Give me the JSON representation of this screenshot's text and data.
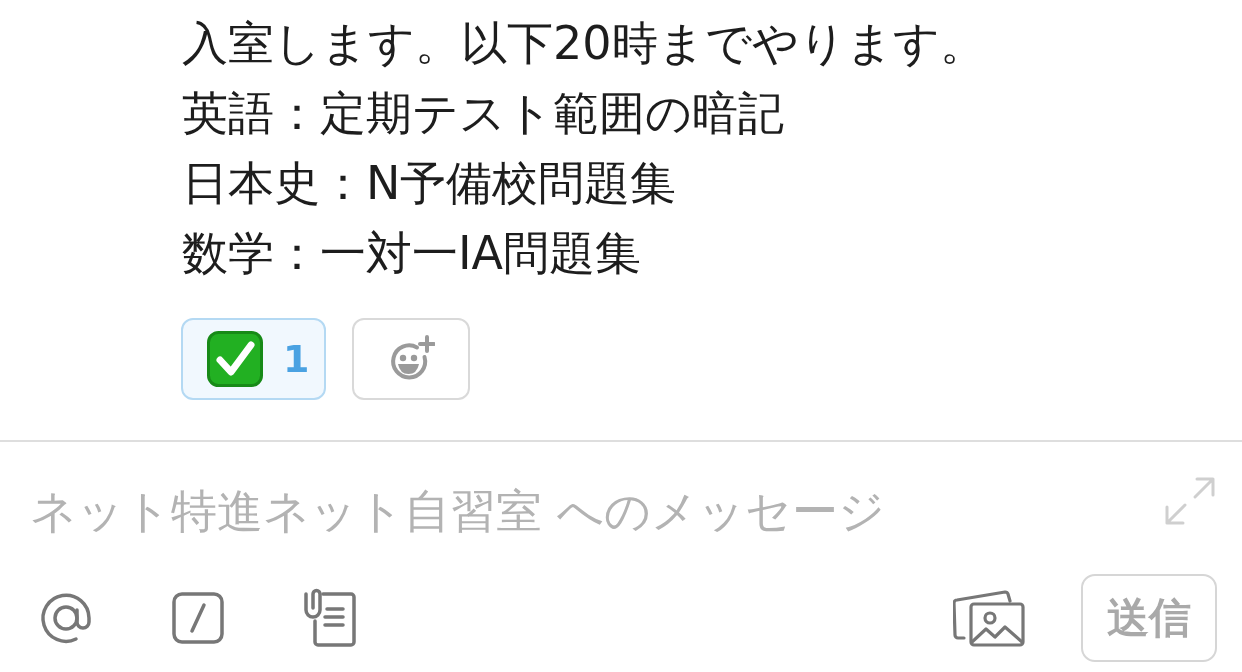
{
  "message": {
    "lines": [
      "入室します。以下20時までやります。",
      "英語：定期テスト範囲の暗記",
      "日本史：N予備校問題集",
      "数学：一対一IA問題集"
    ]
  },
  "reactions": [
    {
      "count": "1",
      "selected": true
    }
  ],
  "composer": {
    "placeholder": "ネット特進ネット自習室 へのメッセージ"
  },
  "send_button": {
    "label": "送信",
    "disabled": true
  }
}
